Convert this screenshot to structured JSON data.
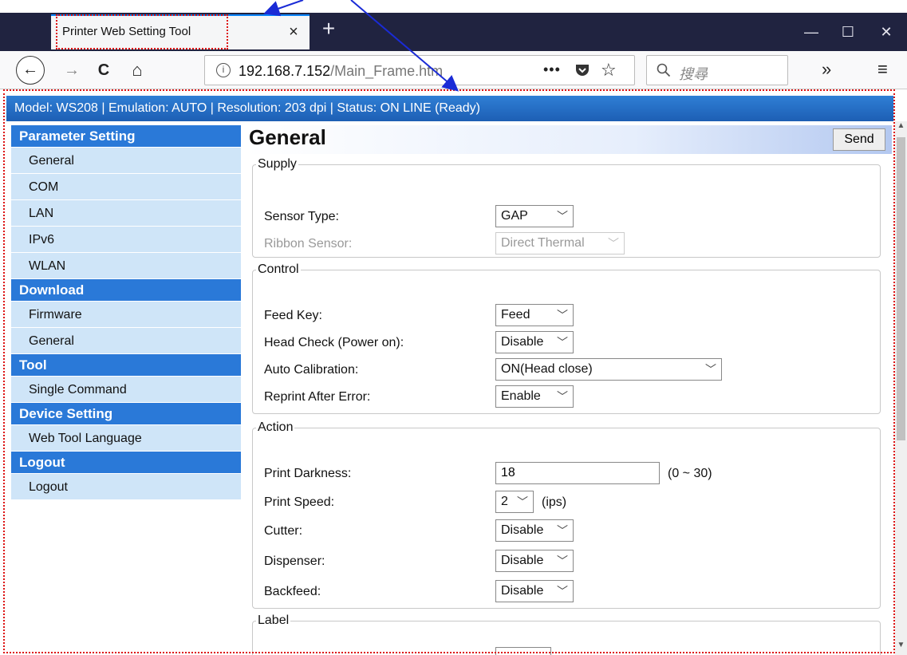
{
  "browser": {
    "tab_title": "Printer Web Setting Tool",
    "tab_close": "×",
    "new_tab": "+",
    "window_controls": {
      "minimize": "—",
      "maximize": "☐",
      "close": "✕"
    },
    "nav": {
      "back": "←",
      "forward": "→",
      "reload": "C",
      "home": "⌂"
    },
    "url": {
      "host": "192.168.7.152",
      "path": "/Main_Frame.htm",
      "info": "i",
      "more": "•••"
    },
    "search_placeholder": "搜尋",
    "overflow": "»",
    "menu": "≡"
  },
  "status_bar": "Model: WS208 | Emulation: AUTO | Resolution: 203 dpi | Status: ON LINE (Ready)",
  "sidebar": {
    "sections": [
      {
        "title": "Parameter Setting",
        "items": [
          "General",
          "COM",
          "LAN",
          "IPv6",
          "WLAN"
        ]
      },
      {
        "title": "Download",
        "items": [
          "Firmware",
          "General"
        ]
      },
      {
        "title": "Tool",
        "items": [
          "Single Command"
        ]
      },
      {
        "title": "Device Setting",
        "items": [
          "Web Tool Language"
        ]
      },
      {
        "title": "Logout",
        "items": [
          "Logout"
        ]
      }
    ]
  },
  "main": {
    "title": "General",
    "send_label": "Send",
    "supply": {
      "legend": "Supply",
      "sensor_type_label": "Sensor Type:",
      "sensor_type_value": "GAP",
      "ribbon_sensor_label": "Ribbon Sensor:",
      "ribbon_sensor_value": "Direct Thermal"
    },
    "control": {
      "legend": "Control",
      "feed_key_label": "Feed Key:",
      "feed_key_value": "Feed",
      "head_check_label": "Head Check (Power on):",
      "head_check_value": "Disable",
      "auto_calibration_label": "Auto Calibration:",
      "auto_calibration_value": "ON(Head close)",
      "reprint_label": "Reprint After Error:",
      "reprint_value": "Enable"
    },
    "action": {
      "legend": "Action",
      "darkness_label": "Print Darkness:",
      "darkness_value": "18",
      "darkness_range": "(0 ~ 30)",
      "speed_label": "Print Speed:",
      "speed_value": "2",
      "speed_unit": "(ips)",
      "cutter_label": "Cutter:",
      "cutter_value": "Disable",
      "dispenser_label": "Dispenser:",
      "dispenser_value": "Disable",
      "backfeed_label": "Backfeed:",
      "backfeed_value": "Disable"
    },
    "label": {
      "legend": "Label"
    }
  },
  "colors": {
    "status_bar": "#1d5fb4",
    "sidebar_header": "#2a79d8",
    "sidebar_item": "#cfe5f8",
    "annotation": "#dd1111",
    "arrow": "#1a2bd6"
  }
}
